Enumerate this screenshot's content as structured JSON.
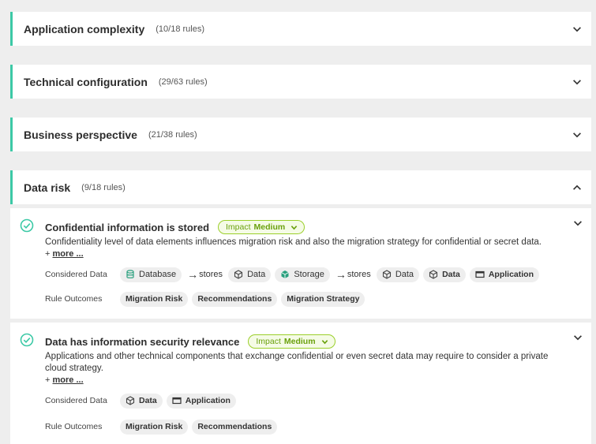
{
  "panels": [
    {
      "title": "Application complexity",
      "count": "(10/18 rules)"
    },
    {
      "title": "Technical configuration",
      "count": "(29/63 rules)"
    },
    {
      "title": "Business perspective",
      "count": "(21/38 rules)"
    },
    {
      "title": "Data risk",
      "count": "(9/18 rules)"
    }
  ],
  "rules": [
    {
      "title": "Confidential information is stored",
      "impact_label": "Impact",
      "impact_value": "Medium",
      "description": "Confidentiality level of data elements influences migration risk and also the migration strategy for confidential or secret data.",
      "more_prefix": "+",
      "more_label": "more ...",
      "considered_label": "Considered Data",
      "considered": {
        "database": "Database",
        "stores1": "stores",
        "data1": "Data",
        "storage": "Storage",
        "stores2": "stores",
        "data2": "Data",
        "data3": "Data",
        "application": "Application"
      },
      "outcomes_label": "Rule Outcomes",
      "outcomes": [
        "Migration Risk",
        "Recommendations",
        "Migration Strategy"
      ]
    },
    {
      "title": "Data has information security relevance",
      "impact_label": "Impact",
      "impact_value": "Medium",
      "description": "Applications and other technical components that exchange confidential or even secret data may require to consider a private cloud strategy.",
      "more_prefix": "+",
      "more_label": "more ...",
      "considered_label": "Considered Data",
      "considered": {
        "data": "Data",
        "application": "Application"
      },
      "outcomes_label": "Rule Outcomes",
      "outcomes": [
        "Migration Risk",
        "Recommendations"
      ]
    }
  ],
  "colors": {
    "accent": "#3cc9a6",
    "impact_border": "#9bcf2a",
    "impact_text": "#6aa10d"
  }
}
